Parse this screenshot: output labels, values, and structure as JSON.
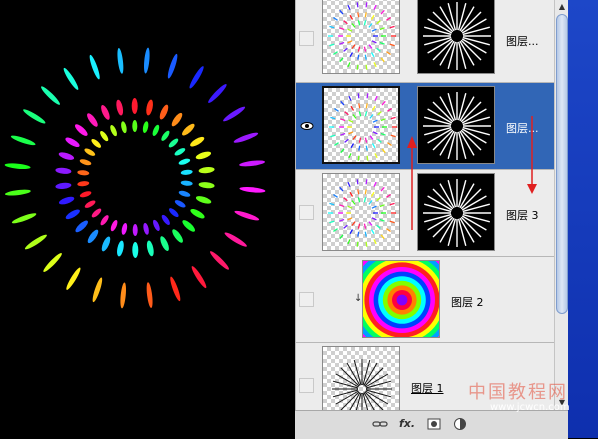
{
  "canvas": {
    "description_icon": "radial-burst-artwork",
    "inner_ring_count": 30,
    "outer_ring_count": 28
  },
  "layers": [
    {
      "name": "图层...",
      "visible": false,
      "selected": false,
      "has_mask": true
    },
    {
      "name": "图层...",
      "visible": true,
      "selected": true,
      "has_mask": true
    },
    {
      "name": "图层 3",
      "visible": false,
      "selected": false,
      "has_mask": true
    },
    {
      "name": "图层 2",
      "visible": false,
      "selected": false,
      "clipped": true,
      "thumbnail": "rainbow-concentric-rings"
    },
    {
      "name": "图层 1",
      "visible": false,
      "selected": false,
      "thumbnail": "white-starburst"
    }
  ],
  "toolbar": {
    "link_icon": "link-icon",
    "fx_label": "fx.",
    "mask_icon": "layer-mask-icon",
    "adjustment_icon": "adjustment-layer-icon"
  },
  "scrollbar": {
    "up_icon": "▲",
    "down_icon": "▼"
  },
  "watermark": {
    "chinese": "中国教程网",
    "url": "www.jcwcn.com"
  },
  "colors": {
    "selection": "#3166b6",
    "arrow": "#e02020",
    "desktop_blue": "#1d47c8"
  }
}
